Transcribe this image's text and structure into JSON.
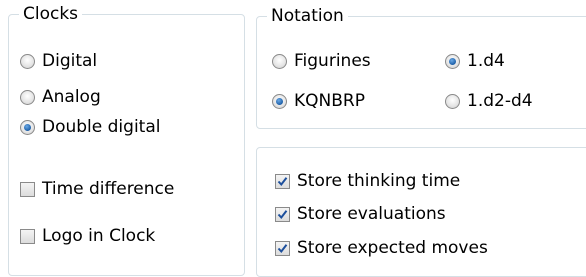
{
  "clocks": {
    "title": "Clocks",
    "options": [
      "Digital",
      "Analog",
      "Double digital"
    ],
    "selected": "Double digital",
    "checkboxes": [
      {
        "label": "Time difference",
        "checked": false
      },
      {
        "label": "Logo in Clock",
        "checked": false
      }
    ]
  },
  "notation": {
    "title": "Notation",
    "piece_style": {
      "options": [
        "Figurines",
        "KQNBRP"
      ],
      "selected": "KQNBRP"
    },
    "move_style": {
      "options": [
        "1.d4",
        "1.d2-d4"
      ],
      "selected": "1.d4"
    }
  },
  "store": {
    "checkboxes": [
      {
        "label": "Store thinking time",
        "checked": true
      },
      {
        "label": "Store evaluations",
        "checked": true
      },
      {
        "label": "Store expected moves",
        "checked": true
      }
    ]
  }
}
